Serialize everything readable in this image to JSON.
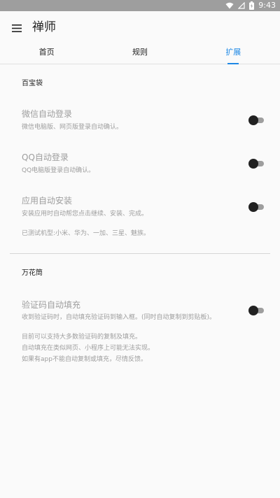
{
  "status_bar": {
    "time": "9:43",
    "icons": [
      "wifi-icon",
      "signal-icon",
      "battery-icon"
    ]
  },
  "app_bar": {
    "title": "禅师",
    "menu_icon": "menu-icon"
  },
  "tabs": [
    {
      "label": "首页",
      "active": false
    },
    {
      "label": "规则",
      "active": false
    },
    {
      "label": "扩展",
      "active": true
    }
  ],
  "sections": {
    "treasure": {
      "title": "百宝袋",
      "items": {
        "wechat_login": {
          "title": "微信自动登录",
          "summary": "微信电脑版、网页版登录自动确认。",
          "enabled": false
        },
        "qq_login": {
          "title": "QQ自动登录",
          "summary": "QQ电脑版登录自动确认。",
          "enabled": false
        },
        "auto_install": {
          "title": "应用自动安装",
          "summary": "安装应用时自动帮您点击继续、安装、完成。",
          "enabled": false
        }
      },
      "tested_models": "已测试机型:小米、华为、一加、三星、魅族。"
    },
    "kaleidoscope": {
      "title": "万花筒",
      "items": {
        "code_fill": {
          "title": "验证码自动填充",
          "summary": "收到验证码时，自动填充验证码到输入框。(同时自动复制到剪贴板)。",
          "enabled": false
        }
      },
      "notes": [
        "目前可以支持大多数验证码的复制及填充。",
        "自动填充在类似网页、小程序上可能无法实现。",
        "如果有app不能自动复制或填充，尽情反馈。"
      ]
    }
  },
  "colors": {
    "accent": "#1e88e5",
    "status_bar": "#9e9e9e",
    "disabled_text": "#9e9e9e"
  }
}
